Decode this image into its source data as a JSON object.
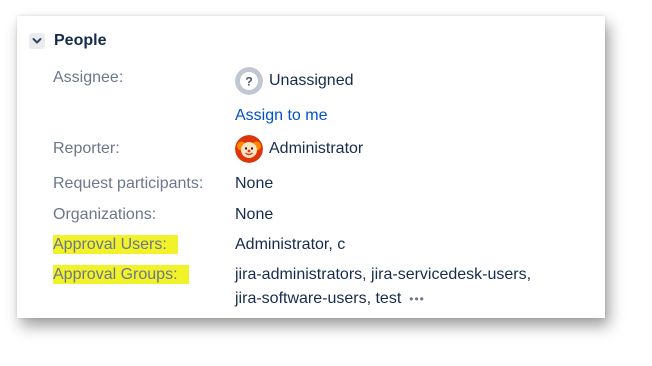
{
  "section": {
    "title": "People",
    "toggle_icon": "chevron-down-icon"
  },
  "fields": {
    "assignee": {
      "label": "Assignee:",
      "value": "Unassigned",
      "avatar_icon": "unknown-user-icon",
      "action": "Assign to me"
    },
    "reporter": {
      "label": "Reporter:",
      "value": "Administrator",
      "avatar_icon": "user-avatar"
    },
    "request_participants": {
      "label": "Request participants:",
      "value": "None"
    },
    "organizations": {
      "label": "Organizations:",
      "value": "None"
    },
    "approval_users": {
      "label": "Approval Users:",
      "value": "Administrator, c",
      "highlight": "#f2f22a"
    },
    "approval_groups": {
      "label": "Approval Groups:",
      "value_line1": "jira-administrators, jira-servicedesk-users,",
      "value_line2": "jira-software-users, test",
      "more_icon": "ellipsis-icon",
      "highlight": "#f2f22a"
    }
  },
  "colors": {
    "label": "#6b778c",
    "text": "#172b4d",
    "link": "#0052cc"
  }
}
